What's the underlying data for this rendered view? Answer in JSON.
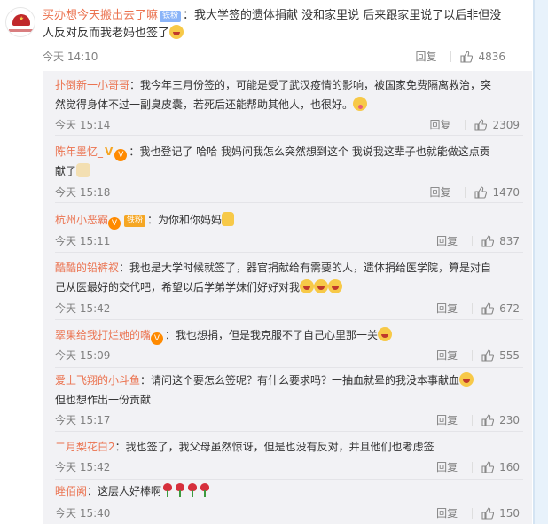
{
  "main": {
    "username": "买办想今天搬出去了嘛",
    "badge": "铁粉",
    "text": "：我大学签的遗体捐献 没和家里说 后来跟家里说了以后非但没人反对反而我老妈也签了",
    "emoji": "laugh-emoji",
    "time": "今天 14:10",
    "reply_label": "回复",
    "likes": "4836"
  },
  "replies": [
    {
      "username": "扑倒新一小哥哥",
      "badges": [],
      "text": "：我今年三月份签的，可能是受了武汉疫情的影响，被国家免费隔离救治，突然觉得身体不过一副臭皮囊，若死后还能帮助其他人，也很好。",
      "emojis": [
        "tongue-emoji"
      ],
      "time": "今天 15:14",
      "reply_label": "回复",
      "likes": "2309"
    },
    {
      "username": "陈年墨忆_",
      "badges": [
        "v",
        "vip"
      ],
      "text": "：我也登记了 哈哈 我妈问我怎么突然想到这个 我说我这辈子也就能做这点贡献了",
      "emojis": [
        "dog-emoji"
      ],
      "time": "今天 15:18",
      "reply_label": "回复",
      "likes": "1470"
    },
    {
      "username": "杭州小恶霸",
      "badges": [
        "vip",
        "tie"
      ],
      "tie_label": "铁粉",
      "text": "：为你和你妈妈",
      "emojis": [
        "thumbs-up-emoji"
      ],
      "time": "今天 15:11",
      "reply_label": "回复",
      "likes": "837"
    },
    {
      "username": "酷酷的铅裤衩",
      "badges": [],
      "text": "：我也是大学时候就签了，器官捐献给有需要的人，遗体捐给医学院，算是对自己从医最好的交代吧，希望以后学弟学妹们好好对我",
      "emojis": [
        "laugh-emoji",
        "laugh-emoji",
        "laugh-emoji"
      ],
      "time": "今天 15:42",
      "reply_label": "回复",
      "likes": "672"
    },
    {
      "username": "翠果给我打烂她的嘴",
      "badges": [
        "vip"
      ],
      "text": "：我也想捐，但是我克服不了自己心里那一关",
      "emojis": [
        "laugh-emoji"
      ],
      "time": "今天 15:09",
      "reply_label": "回复",
      "likes": "555"
    },
    {
      "username": "爱上飞翔的小斗鱼",
      "badges": [],
      "text": "：请问这个要怎么签呢？有什么要求吗？一抽血就晕的我没本事献血",
      "text2": "但也想作出一份贡献",
      "emojis": [
        "laugh-emoji"
      ],
      "time": "今天 15:17",
      "reply_label": "回复",
      "likes": "230"
    },
    {
      "username": "二月梨花白2",
      "badges": [],
      "text": "：我也签了，我父母虽然惊讶，但是也没有反对，并且他们也考虑签",
      "emojis": [],
      "time": "今天 15:42",
      "reply_label": "回复",
      "likes": "160"
    },
    {
      "username": "睉佰阙",
      "badges": [],
      "text": "：这层人好棒啊",
      "emojis": [
        "rose-emoji",
        "rose-emoji",
        "rose-emoji",
        "rose-emoji"
      ],
      "time": "今天 15:40",
      "reply_label": "回复",
      "likes": "150"
    }
  ],
  "colors": {
    "username": "#eb7350",
    "reply_username": "#eb7350",
    "reply_bg": "#f2f2f5",
    "meta": "#808080"
  }
}
